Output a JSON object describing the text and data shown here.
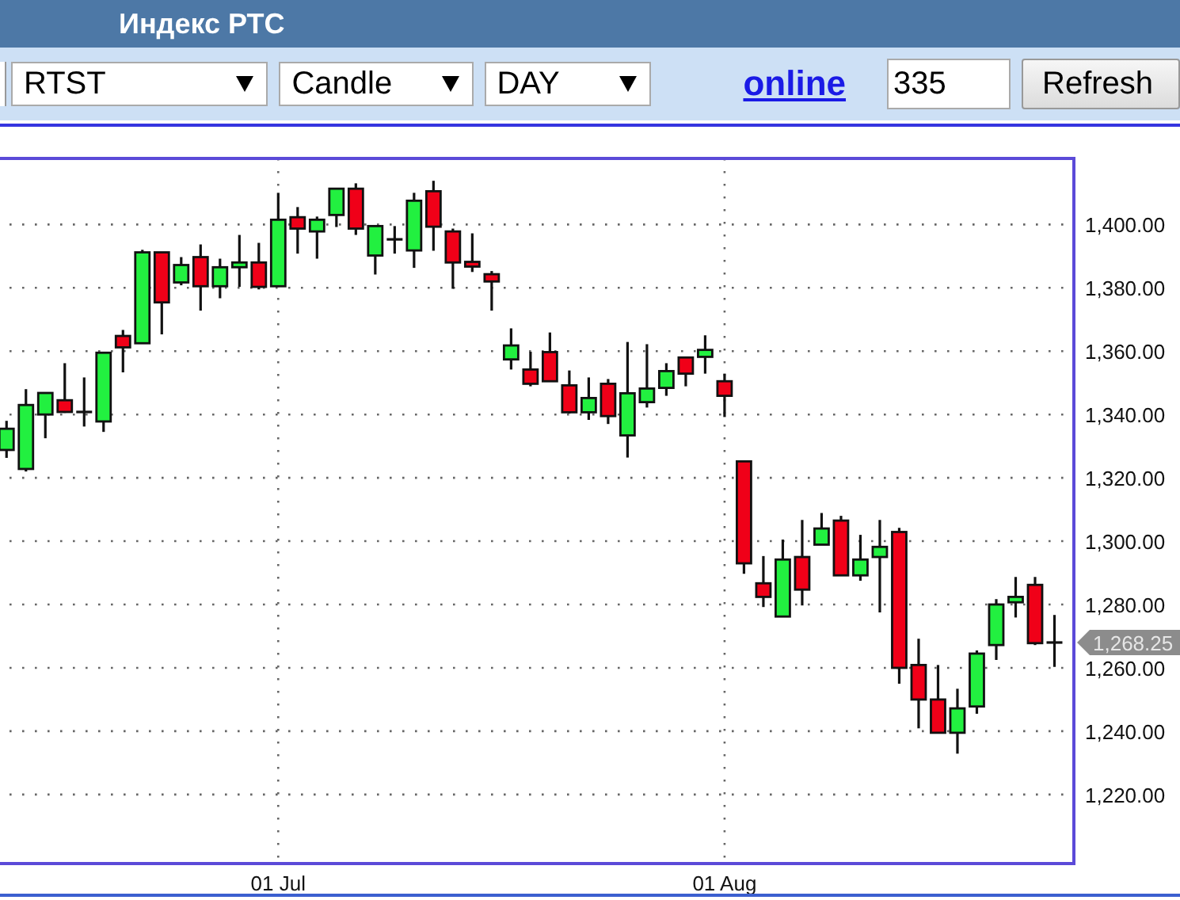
{
  "window": {
    "title": "Индекс РТС"
  },
  "toolbar": {
    "dropdowns": [
      {
        "value": "RTST"
      },
      {
        "value": "Candle"
      },
      {
        "value": "DAY"
      }
    ],
    "link": "online",
    "count_input": {
      "value": "335"
    },
    "refresh_button": "Refresh"
  },
  "chart": {
    "chart_data": {
      "type": "candlestick",
      "grid": true,
      "ylim": [
        1198.2,
        1420.85
      ],
      "categories": [
        null,
        null,
        null,
        null,
        null,
        null,
        null,
        null,
        null,
        null,
        null,
        null,
        null,
        null,
        "01 Jul",
        null,
        null,
        null,
        null,
        null,
        null,
        null,
        null,
        null,
        null,
        null,
        null,
        null,
        null,
        null,
        null,
        null,
        null,
        null,
        null,
        null,
        null,
        "01 Aug",
        null,
        null,
        null,
        null,
        null,
        null,
        null,
        null,
        null,
        null,
        null,
        null,
        null,
        null,
        null,
        null,
        null
      ],
      "yticks": [
        {
          "value": 1400,
          "label": "1,400.00"
        },
        {
          "value": 1380,
          "label": "1,380.00"
        },
        {
          "value": 1360,
          "label": "1,360.00"
        },
        {
          "value": 1340,
          "label": "1,340.00"
        },
        {
          "value": 1320,
          "label": "1,320.00"
        },
        {
          "value": 1300,
          "label": "1,300.00"
        },
        {
          "value": 1280,
          "label": "1,280.00"
        },
        {
          "value": 1260,
          "label": "1,260.00"
        },
        {
          "value": 1240,
          "label": "1,240.00"
        },
        {
          "value": 1220,
          "label": "1,220.00"
        }
      ],
      "ohlc": [
        [
          1328.8,
          1338,
          1326.3,
          1335.5
        ],
        [
          1322.8,
          1348,
          1322,
          1343
        ],
        [
          1340,
          1346.8,
          1332.5,
          1346.8
        ],
        [
          1344.5,
          1356.2,
          1340.5,
          1340.8
        ],
        [
          1340.8,
          1351.7,
          1336.2,
          1340.8
        ],
        [
          1337.8,
          1359.5,
          1334.5,
          1359.5
        ],
        [
          1364.8,
          1366.7,
          1353.3,
          1361.2
        ],
        [
          1362.5,
          1392,
          1362.5,
          1391.2
        ],
        [
          1391.2,
          1391.2,
          1365.3,
          1375.4
        ],
        [
          1381.7,
          1389.7,
          1380.8,
          1387.2
        ],
        [
          1389.7,
          1393.7,
          1372.8,
          1380.5
        ],
        [
          1380.5,
          1389.2,
          1376.7,
          1386.5
        ],
        [
          1386.5,
          1396.7,
          1380.3,
          1388
        ],
        [
          1388,
          1394.2,
          1379.5,
          1380.3
        ],
        [
          1380.5,
          1410,
          1380.5,
          1401.5
        ],
        [
          1402.3,
          1405.5,
          1390.8,
          1398.7
        ],
        [
          1397.8,
          1402.5,
          1389.2,
          1401.5
        ],
        [
          1403,
          1411.3,
          1399.2,
          1411.3
        ],
        [
          1411.3,
          1413,
          1396.7,
          1398.7
        ],
        [
          1390.2,
          1399.5,
          1384.2,
          1399.5
        ],
        [
          1395.3,
          1399.5,
          1390.8,
          1395.3
        ],
        [
          1391.8,
          1410,
          1386.3,
          1407.5
        ],
        [
          1410.5,
          1413.8,
          1391.7,
          1399.3
        ],
        [
          1397.8,
          1398.7,
          1379.7,
          1388
        ],
        [
          1388.2,
          1397.2,
          1385,
          1386.7
        ],
        [
          1384.3,
          1385.3,
          1372.8,
          1382
        ],
        [
          1357.4,
          1367.2,
          1354.2,
          1361.8
        ],
        [
          1354.2,
          1359.8,
          1348.9,
          1349.7
        ],
        [
          1359.7,
          1365.9,
          1350.5,
          1350.5
        ],
        [
          1349.2,
          1353.9,
          1340.3,
          1340.7
        ],
        [
          1340.7,
          1351.7,
          1338.3,
          1345.2
        ],
        [
          1349.7,
          1351.2,
          1337,
          1339.5
        ],
        [
          1333.4,
          1362.9,
          1326.4,
          1346.7
        ],
        [
          1343.9,
          1362.2,
          1342.2,
          1348.2
        ],
        [
          1348.4,
          1356.2,
          1345.9,
          1353.7
        ],
        [
          1358,
          1358,
          1348.9,
          1352.9
        ],
        [
          1358.2,
          1365,
          1352.9,
          1360.4
        ],
        [
          1350.5,
          1352.9,
          1339.2,
          1345.9
        ],
        [
          1325.2,
          1325.2,
          1289.7,
          1293
        ],
        [
          1286.7,
          1295.3,
          1279.2,
          1282.4
        ],
        [
          1276.2,
          1300.5,
          1276.2,
          1294.2
        ],
        [
          1295,
          1306.7,
          1279.7,
          1284.7
        ],
        [
          1298.9,
          1308.9,
          1298.9,
          1304
        ],
        [
          1306.5,
          1308,
          1289.2,
          1289.2
        ],
        [
          1289.2,
          1302,
          1287.5,
          1294.2
        ],
        [
          1295,
          1306.7,
          1277.5,
          1298.2
        ],
        [
          1302.9,
          1304.2,
          1255,
          1260
        ],
        [
          1260.9,
          1269.2,
          1240.9,
          1250
        ],
        [
          1250,
          1260.9,
          1239.5,
          1239.5
        ],
        [
          1239.5,
          1253.4,
          1232.9,
          1247.2
        ],
        [
          1247.8,
          1265.5,
          1245.5,
          1264.5
        ],
        [
          1267.2,
          1281.7,
          1262.5,
          1280
        ],
        [
          1280.7,
          1288.7,
          1275.9,
          1282.4
        ],
        [
          1286.2,
          1288.7,
          1267.2,
          1267.8
        ],
        [
          1268,
          1276.7,
          1260.3,
          1268
        ]
      ],
      "annotations": [
        "1,268.25"
      ]
    }
  }
}
